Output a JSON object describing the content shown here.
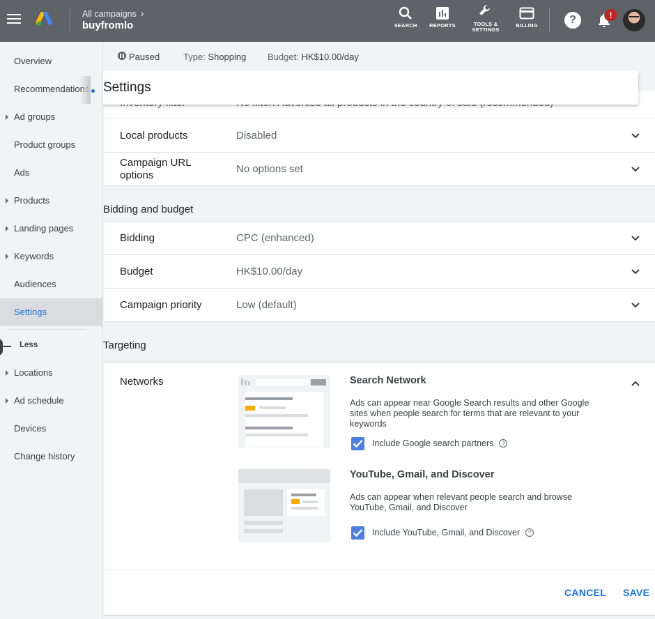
{
  "topbar": {
    "breadcrumb_parent": "All campaigns",
    "campaign_name": "buyfromlo",
    "buttons": [
      {
        "label": "SEARCH",
        "icon": "search-icon"
      },
      {
        "label": "REPORTS",
        "icon": "reports-icon"
      },
      {
        "label": "TOOLS &",
        "label2": "SETTINGS",
        "icon": "wrench-icon"
      },
      {
        "label": "BILLING",
        "icon": "credit-card-icon"
      }
    ],
    "help_glyph": "?",
    "notification_badge": "!",
    "colors": {
      "bar": "#5f6368",
      "badge": "#c5221f"
    }
  },
  "sidebar": {
    "items": [
      {
        "label": "Overview",
        "expandable": false
      },
      {
        "label": "Recommendations",
        "expandable": false
      },
      {
        "label": "Ad groups",
        "expandable": true
      },
      {
        "label": "Product groups",
        "expandable": false
      },
      {
        "label": "Ads",
        "expandable": false
      },
      {
        "label": "Products",
        "expandable": true
      },
      {
        "label": "Landing pages",
        "expandable": true
      },
      {
        "label": "Keywords",
        "expandable": true
      },
      {
        "label": "Audiences",
        "expandable": false
      },
      {
        "label": "Settings",
        "expandable": false,
        "active": true
      }
    ],
    "less_label": "Less",
    "more_items": [
      {
        "label": "Locations",
        "expandable": true
      },
      {
        "label": "Ad schedule",
        "expandable": true
      },
      {
        "label": "Devices",
        "expandable": false
      },
      {
        "label": "Change history",
        "expandable": false
      }
    ]
  },
  "status": {
    "state": "Paused",
    "type_key": "Type:",
    "type_value": "Shopping",
    "budget_key": "Budget:",
    "budget_value": "HK$10.00/day"
  },
  "settings": {
    "title": "Settings",
    "ghost_row_label": "Inventory filter",
    "ghost_row_value": "No filter: Advertise all products in the country of sale (recommended)",
    "general_rows": [
      {
        "label": "Local products",
        "value": "Disabled"
      },
      {
        "label": "Campaign URL",
        "label2": "options",
        "value": "No options set"
      }
    ],
    "bidding_section": "Bidding and budget",
    "bidding_rows": [
      {
        "label": "Bidding",
        "value": "CPC (enhanced)"
      },
      {
        "label": "Budget",
        "value": "HK$10.00/day"
      },
      {
        "label": "Campaign priority",
        "value": "Low (default)"
      }
    ],
    "targeting_section": "Targeting",
    "networks": {
      "label": "Networks",
      "search": {
        "heading": "Search Network",
        "description": "Ads can appear near Google Search results and other Google sites when people search for terms that are relevant to your keywords",
        "checkbox_label": "Include Google search partners",
        "checked": true
      },
      "display": {
        "heading": "YouTube, Gmail, and Discover",
        "description": "Ads can appear when relevant people search and browse YouTube, Gmail, and Discover",
        "checkbox_label": "Include YouTube, Gmail, and Discover",
        "checked": true
      }
    },
    "cancel_label": "CANCEL",
    "save_label": "SAVE"
  },
  "accent_color": "#1a73e8"
}
